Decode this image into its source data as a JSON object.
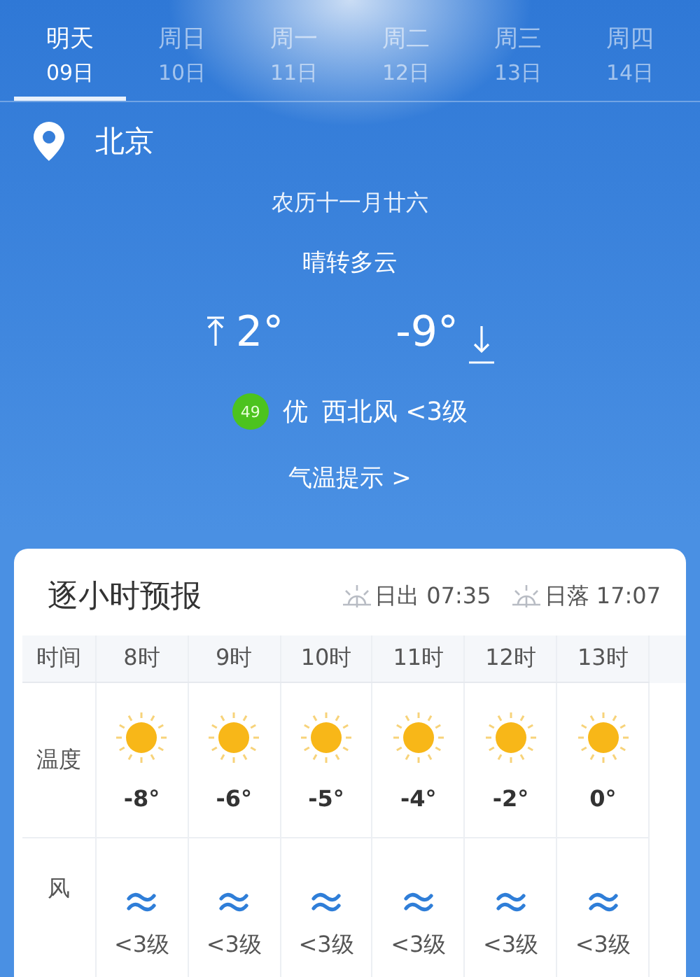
{
  "tabs": [
    {
      "weekday": "明天",
      "date": "09日",
      "selected": true
    },
    {
      "weekday": "周日",
      "date": "10日",
      "selected": false
    },
    {
      "weekday": "周一",
      "date": "11日",
      "selected": false
    },
    {
      "weekday": "周二",
      "date": "12日",
      "selected": false
    },
    {
      "weekday": "周三",
      "date": "13日",
      "selected": false
    },
    {
      "weekday": "周四",
      "date": "14日",
      "selected": false
    }
  ],
  "location": {
    "city": "北京"
  },
  "lunar_date": "农历十一月廿六",
  "condition": "晴转多云",
  "high_temp": "2°",
  "low_temp": "-9°",
  "air_quality": {
    "aqi": "49",
    "level": "优"
  },
  "wind": "西北风 <3级",
  "temperature_tip": "气温提示 >",
  "hourly": {
    "title": "逐小时预报",
    "sunrise": "日出 07:35",
    "sunset": "日落 17:07",
    "row_labels": [
      "时间",
      "温度",
      "风"
    ],
    "hours": [
      {
        "time": "8时",
        "temp": "-8°",
        "wind": "<3级"
      },
      {
        "time": "9时",
        "temp": "-6°",
        "wind": "<3级"
      },
      {
        "time": "10时",
        "temp": "-5°",
        "wind": "<3级"
      },
      {
        "time": "11时",
        "temp": "-4°",
        "wind": "<3级"
      },
      {
        "time": "12时",
        "temp": "-2°",
        "wind": "<3级"
      },
      {
        "time": "13时",
        "temp": "0°",
        "wind": "<3级"
      }
    ]
  }
}
